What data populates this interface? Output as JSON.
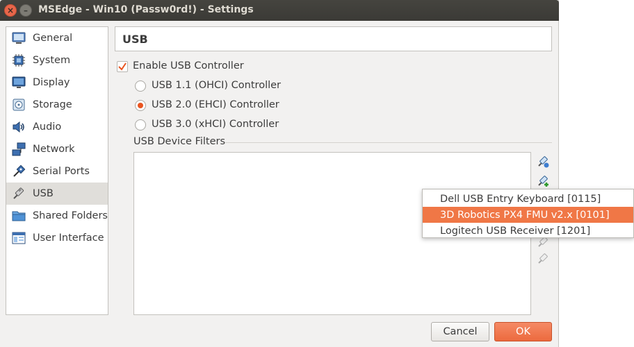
{
  "window": {
    "title": "MSEdge - Win10 (Passw0rd!) - Settings",
    "close_glyph": "×",
    "minimize_glyph": "–"
  },
  "sidebar": {
    "items": [
      {
        "label": "General",
        "icon": "general-icon"
      },
      {
        "label": "System",
        "icon": "system-chip-icon"
      },
      {
        "label": "Display",
        "icon": "display-monitor-icon"
      },
      {
        "label": "Storage",
        "icon": "storage-disk-icon"
      },
      {
        "label": "Audio",
        "icon": "audio-speaker-icon"
      },
      {
        "label": "Network",
        "icon": "network-icon"
      },
      {
        "label": "Serial Ports",
        "icon": "serial-port-icon"
      },
      {
        "label": "USB",
        "icon": "usb-plug-icon",
        "selected": true
      },
      {
        "label": "Shared Folders",
        "icon": "folder-icon"
      },
      {
        "label": "User Interface",
        "icon": "user-interface-icon"
      }
    ]
  },
  "section": {
    "title": "USB"
  },
  "usb": {
    "enable_label": "Enable USB Controller",
    "enabled": true,
    "options": [
      {
        "label": "USB 1.1 (OHCI) Controller",
        "checked": false
      },
      {
        "label": "USB 2.0 (EHCI) Controller",
        "checked": true
      },
      {
        "label": "USB 3.0 (xHCI) Controller",
        "checked": false
      }
    ],
    "filters_label": "USB Device Filters"
  },
  "dropdown": {
    "items": [
      {
        "label": "Dell USB Entry Keyboard [0115]",
        "highlighted": false
      },
      {
        "label": "3D Robotics PX4 FMU v2.x [0101]",
        "highlighted": true
      },
      {
        "label": "Logitech USB Receiver [1201]",
        "highlighted": false
      }
    ]
  },
  "buttons": {
    "cancel": "Cancel",
    "ok": "OK"
  },
  "colors": {
    "accent": "#e9541f",
    "highlight": "#f07746",
    "titlebar": "#3b3a36"
  }
}
